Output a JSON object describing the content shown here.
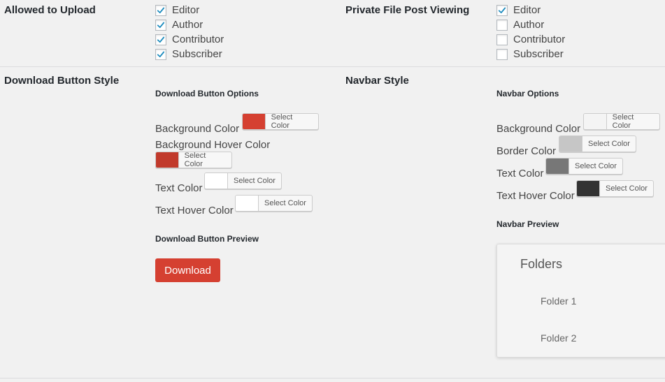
{
  "upload": {
    "heading": "Allowed to Upload",
    "options": [
      {
        "label": "Editor",
        "checked": true
      },
      {
        "label": "Author",
        "checked": true
      },
      {
        "label": "Contributor",
        "checked": true
      },
      {
        "label": "Subscriber",
        "checked": true
      }
    ]
  },
  "private_viewing": {
    "heading": "Private File Post Viewing",
    "options": [
      {
        "label": "Editor",
        "checked": true
      },
      {
        "label": "Author",
        "checked": false
      },
      {
        "label": "Contributor",
        "checked": false
      },
      {
        "label": "Subscriber",
        "checked": false
      }
    ]
  },
  "download_style": {
    "heading": "Download Button Style",
    "options_title": "Download Button Options",
    "colors": [
      {
        "label": "Background Color",
        "button": "Select Color",
        "value": "#d54031"
      },
      {
        "label": "Background Hover Color",
        "button": "Select Color",
        "value": "#c13a2c"
      },
      {
        "label": "Text Color",
        "button": "Select Color",
        "value": "#ffffff"
      },
      {
        "label": "Text Hover Color",
        "button": "Select Color",
        "value": "#ffffff"
      }
    ],
    "preview_title": "Download Button Preview",
    "preview_button": "Download"
  },
  "navbar_style": {
    "heading": "Navbar Style",
    "options_title": "Navbar Options",
    "colors": [
      {
        "label": "Background Color",
        "button": "Select Color",
        "value": "#f4f4f4"
      },
      {
        "label": "Border Color",
        "button": "Select Color",
        "value": "#c6c6c6"
      },
      {
        "label": "Text Color",
        "button": "Select Color",
        "value": "#777777"
      },
      {
        "label": "Text Hover Color",
        "button": "Select Color",
        "value": "#333333"
      }
    ],
    "preview_title": "Navbar Preview",
    "preview": {
      "title": "Folders",
      "items": [
        "Folder 1",
        "Folder 2"
      ]
    }
  }
}
